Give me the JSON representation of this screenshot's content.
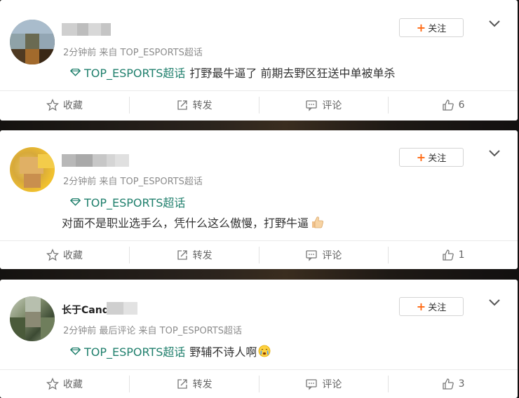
{
  "follow_label": "关注",
  "action_labels": {
    "favorite": "收藏",
    "repost": "转发",
    "comment": "评论"
  },
  "colors": {
    "topic": "#1f7f6c",
    "follow_plus": "#ff6a13",
    "meta": "#8c8c8c"
  },
  "posts": [
    {
      "meta": "2分钟前 来自 TOP_ESPORTS超话",
      "topic": "TOP_ESPORTS超话",
      "text": "打野最牛逼了 前期去野区狂送中单被单杀",
      "likes": "6"
    },
    {
      "meta": "2分钟前 来自 TOP_ESPORTS超话",
      "topic": "TOP_ESPORTS超话",
      "text": "对面不是职业选手么，凭什么这么傲慢，打野牛逼",
      "likes": "1"
    },
    {
      "username_visible": "长于Candle",
      "meta": "2分钟前 最后评论 来自 TOP_ESPORTS超话",
      "topic": "TOP_ESPORTS超话",
      "text": "野辅不诗人啊",
      "likes": "3"
    }
  ]
}
